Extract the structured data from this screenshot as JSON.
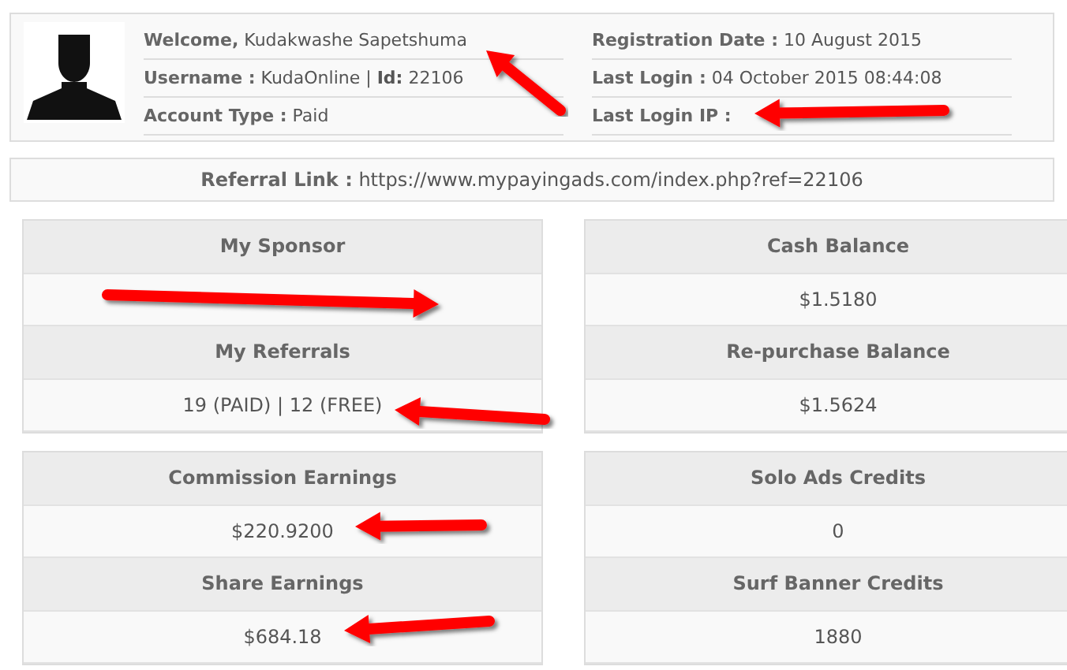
{
  "profile": {
    "left": [
      {
        "label": "Welcome,",
        "value": "Kudakwashe Sapetshuma"
      },
      {
        "label": "Username :",
        "value": "KudaOnline | **Id:** 22106"
      },
      {
        "label": "Account Type :",
        "value": "Paid"
      }
    ],
    "right": [
      {
        "label": "Registration Date :",
        "value": "10 August 2015"
      },
      {
        "label": "Last Login :",
        "value": "04 October 2015 08:44:08"
      },
      {
        "label": "Last Login IP :"
      }
    ]
  },
  "referral": {
    "label": "Referral Link :",
    "value": "https://www.mypayingads.com/index.php?ref=22106"
  },
  "groups": [
    {
      "left": [
        {
          "title": "My Sponsor"
        },
        {
          "title": "My Referrals",
          "value": "19 (PAID) | 12 (FREE)"
        }
      ],
      "right": [
        {
          "title": "Cash Balance",
          "value": "$1.5180"
        },
        {
          "title": "Re-purchase Balance",
          "value": "$1.5624"
        }
      ]
    },
    {
      "left": [
        {
          "title": "Commission Earnings",
          "value": "$220.9200"
        },
        {
          "title": "Share Earnings",
          "value": "$684.18"
        }
      ],
      "right": [
        {
          "title": "Solo Ads Credits",
          "value": "0"
        },
        {
          "title": "Surf Banner Credits",
          "value": "1880"
        }
      ]
    }
  ]
}
